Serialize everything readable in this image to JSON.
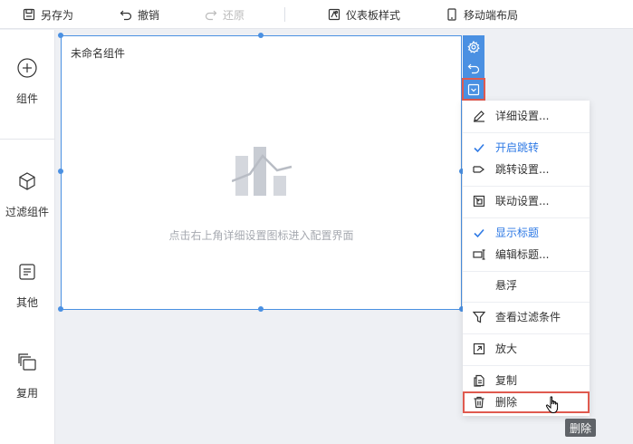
{
  "toolbar": {
    "save_as": "另存为",
    "undo": "撤销",
    "redo": "还原",
    "dashboard_style": "仪表板样式",
    "mobile_layout": "移动端布局"
  },
  "sidebar": {
    "items": [
      {
        "label": "组件",
        "icon": "plus-circle-icon"
      },
      {
        "label": "过滤组件",
        "icon": "cube-icon"
      },
      {
        "label": "其他",
        "icon": "list-icon"
      },
      {
        "label": "复用",
        "icon": "stack-icon"
      }
    ]
  },
  "widget": {
    "title": "未命名组件",
    "placeholder": "点击右上角详细设置图标进入配置界面"
  },
  "widget_tools": [
    "gear-icon",
    "undo-icon",
    "dropdown-icon"
  ],
  "menu": {
    "items": [
      {
        "label": "详细设置...",
        "icon": "pencil-icon"
      },
      {
        "label": "开启跳转",
        "icon": "check-icon",
        "checked": true
      },
      {
        "label": "跳转设置...",
        "icon": "jump-icon"
      },
      {
        "label": "联动设置...",
        "icon": "link-icon"
      },
      {
        "label": "显示标题",
        "icon": "check-icon",
        "checked": true
      },
      {
        "label": "编辑标题...",
        "icon": "edit-title-icon"
      },
      {
        "label": "悬浮",
        "icon": ""
      },
      {
        "label": "查看过滤条件",
        "icon": "filter-icon"
      },
      {
        "label": "放大",
        "icon": "expand-icon"
      },
      {
        "label": "复制",
        "icon": "copy-icon"
      },
      {
        "label": "删除",
        "icon": "trash-icon"
      }
    ]
  },
  "tooltip": "删除",
  "colors": {
    "accent": "#4a90e2",
    "checked_text": "#2f7ae5",
    "highlight_border": "#e05a4f",
    "placeholder_icon": "#c8ccd3"
  }
}
